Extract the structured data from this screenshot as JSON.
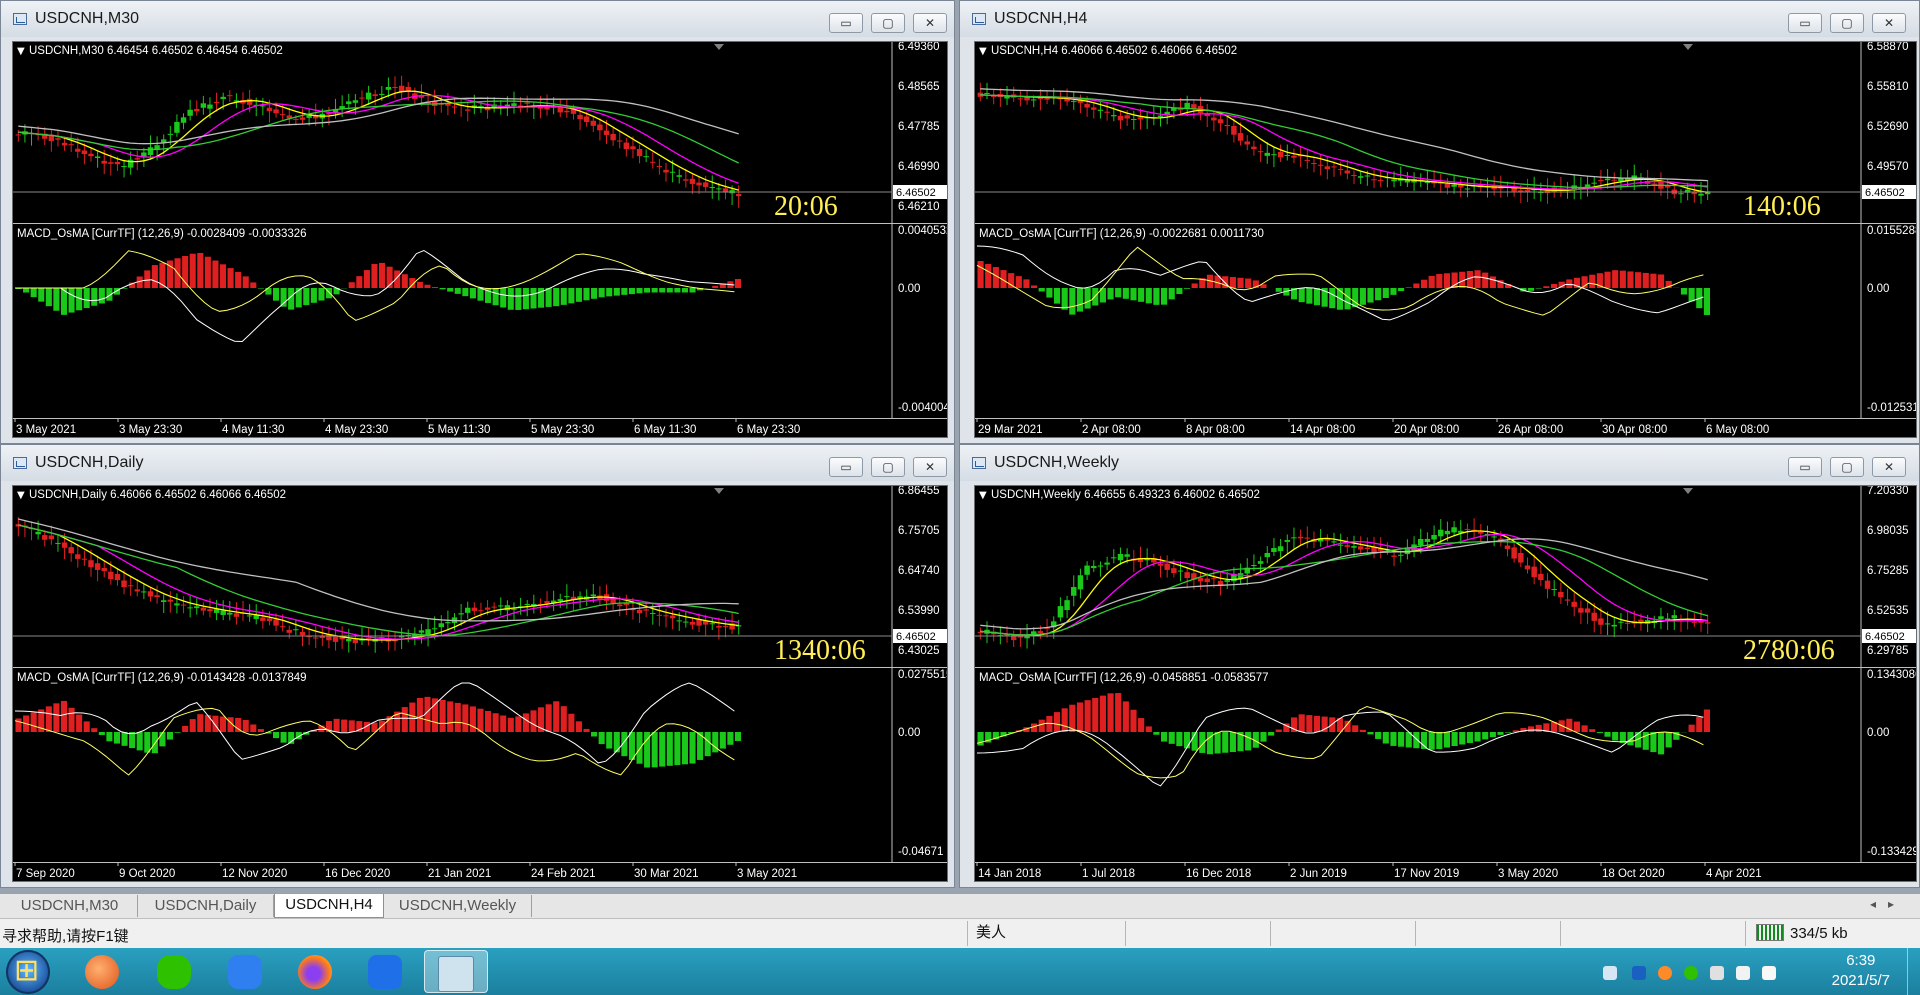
{
  "windows": [
    {
      "title": "USDCNH,M30",
      "main_header": "USDCNH,M30  6.46454 6.46502 6.46454 6.46502",
      "main_prices": [
        "6.49360",
        "6.48565",
        "6.47785",
        "6.46990",
        "6.46210"
      ],
      "current_price": "6.46502",
      "countdown": "20:06",
      "sub_header": "MACD_OsMA [CurrTF] (12,26,9) -0.0028409 -0.0033326",
      "sub_prices": [
        "0.0040532",
        "0.00",
        "-0.0040044"
      ],
      "time_labels": [
        "3 May 2021",
        "3 May 23:30",
        "4 May 11:30",
        "4 May 23:30",
        "5 May 11:30",
        "5 May 23:30",
        "6 May 11:30",
        "6 May 23:30"
      ]
    },
    {
      "title": "USDCNH,H4",
      "main_header": "USDCNH,H4  6.46066 6.46502 6.46066 6.46502",
      "main_prices": [
        "6.58870",
        "6.55810",
        "6.52690",
        "6.49570"
      ],
      "current_price": "6.46502",
      "countdown": "140:06",
      "sub_header": "MACD_OsMA [CurrTF] (12,26,9) -0.0022681 0.0011730",
      "sub_prices": [
        "0.0155288",
        "0.00",
        "-0.0125312"
      ],
      "time_labels": [
        "29 Mar 2021",
        "2 Apr 08:00",
        "8 Apr 08:00",
        "14 Apr 08:00",
        "20 Apr 08:00",
        "26 Apr 08:00",
        "30 Apr 08:00",
        "6 May 08:00"
      ]
    },
    {
      "title": "USDCNH,Daily",
      "main_header": "USDCNH,Daily  6.46066 6.46502 6.46066 6.46502",
      "main_prices": [
        "6.86455",
        "6.75705",
        "6.64740",
        "6.53990",
        "6.43025"
      ],
      "current_price": "6.46502",
      "countdown": "1340:06",
      "sub_header": "MACD_OsMA [CurrTF] (12,26,9) -0.0143428 -0.0137849",
      "sub_prices": [
        "0.0275515",
        "0.00",
        "-0.04671"
      ],
      "time_labels": [
        "7 Sep 2020",
        "9 Oct 2020",
        "12 Nov 2020",
        "16 Dec 2020",
        "21 Jan 2021",
        "24 Feb 2021",
        "30 Mar 2021",
        "3 May 2021"
      ]
    },
    {
      "title": "USDCNH,Weekly",
      "main_header": "USDCNH,Weekly  6.46655 6.49323 6.46002 6.46502",
      "main_prices": [
        "7.20330",
        "6.98035",
        "6.75285",
        "6.52535",
        "6.29785"
      ],
      "current_price": "6.46502",
      "countdown": "2780:06",
      "sub_header": "MACD_OsMA [CurrTF] (12,26,9) -0.0458851 -0.0583577",
      "sub_prices": [
        "0.1343086",
        "0.00",
        "-0.1334299"
      ],
      "time_labels": [
        "14 Jan 2018",
        "1 Jul 2018",
        "16 Dec 2018",
        "2 Jun 2019",
        "17 Nov 2019",
        "3 May 2020",
        "18 Oct 2020",
        "4 Apr 2021"
      ]
    }
  ],
  "window_buttons": {
    "minimize": "▭",
    "maximize": "▢",
    "close": "✕"
  },
  "tabs": [
    "USDCNH,M30",
    "USDCNH,Daily",
    "USDCNH,H4",
    "USDCNH,Weekly"
  ],
  "active_tab": "USDCNH,H4",
  "tab_arrows": "◂▸",
  "status": {
    "help": "寻求帮助,请按F1键",
    "profile": "美人",
    "network": "334/5 kb"
  },
  "clock": {
    "time": "6:39",
    "date": "2021/5/7"
  },
  "colors": {
    "bull_candle": "#19c819",
    "bear_candle": "#e02020",
    "ma_fast": "#ffff00",
    "ma_mid": "#ff00ff",
    "ma_slow": "#33cc33",
    "ma_slowest": "#c0c0c0",
    "countdown": "#ffee55"
  },
  "taskbar_apps": [
    "app-orange-icon",
    "wechat-icon",
    "feishu-icon",
    "firefox-icon",
    "lark-icon",
    "mt4-icon"
  ]
}
